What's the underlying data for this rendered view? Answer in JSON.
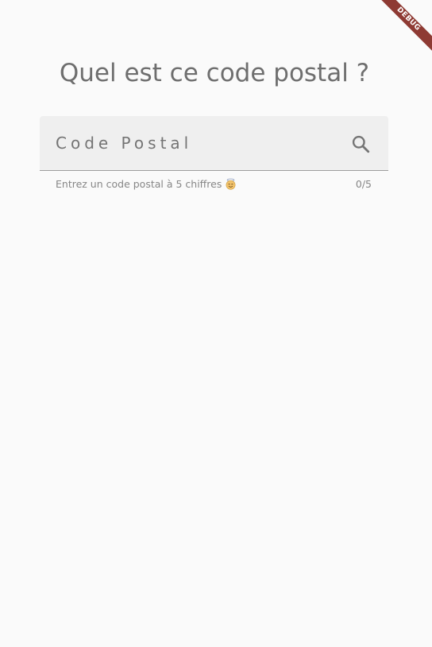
{
  "debug_banner": {
    "label": "DEBUG",
    "color": "#8e3a33"
  },
  "page": {
    "title": "Quel est ce code postal ?"
  },
  "postal_field": {
    "placeholder": "Code Postal",
    "value": "",
    "helper_text": "Entrez un code postal à 5 chiffres",
    "helper_emoji": "smiling-face-with-halo-icon",
    "counter": "0/5",
    "trailing_icon": "search-icon"
  },
  "colors": {
    "background": "#fafafa",
    "field_fill": "#efefef",
    "underline": "#9e9e9e",
    "text": "#6e6e6e"
  }
}
